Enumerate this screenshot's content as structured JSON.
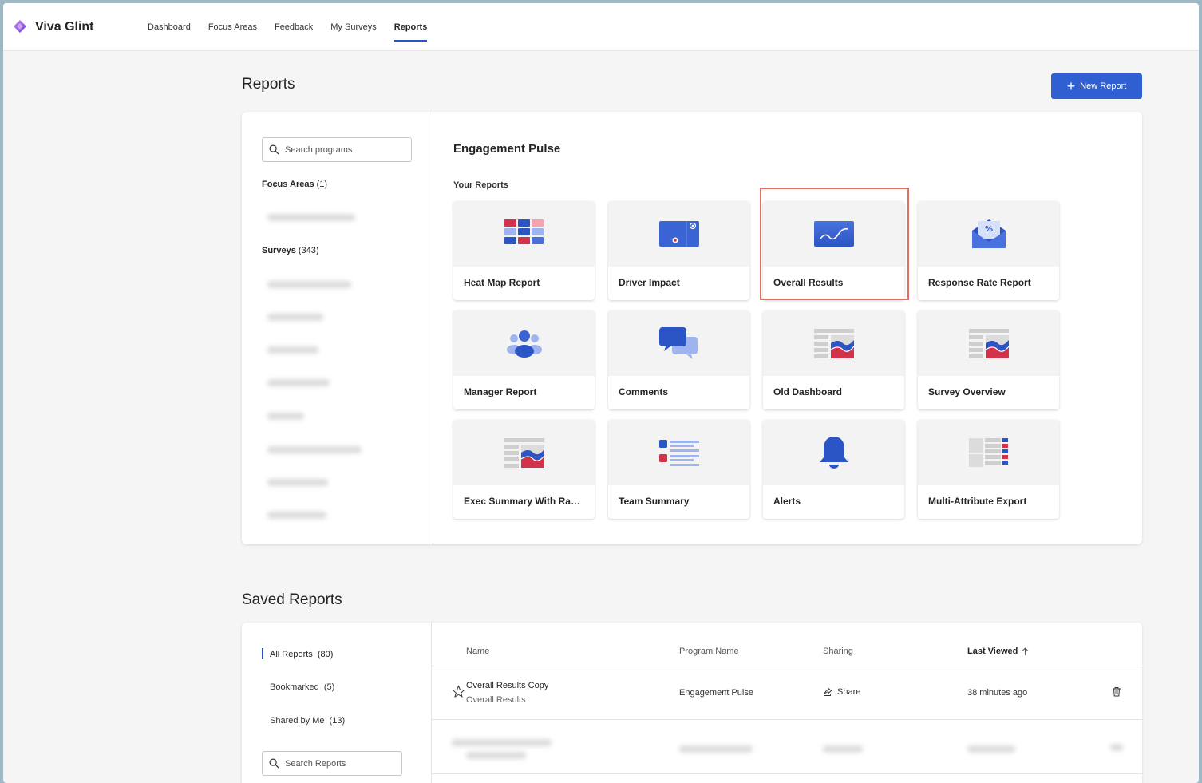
{
  "app": {
    "name": "Viva Glint"
  },
  "nav": {
    "items": [
      {
        "label": "Dashboard"
      },
      {
        "label": "Focus Areas"
      },
      {
        "label": "Feedback"
      },
      {
        "label": "My Surveys"
      },
      {
        "label": "Reports"
      }
    ],
    "active": "Reports"
  },
  "reports": {
    "title": "Reports",
    "new_report_label": "New Report",
    "search_placeholder": "Search programs",
    "focus_areas": {
      "label": "Focus Areas",
      "count": "(1)"
    },
    "surveys": {
      "label": "Surveys",
      "count": "(343)"
    },
    "program_title": "Engagement Pulse",
    "your_reports_label": "Your Reports",
    "cards": [
      {
        "label": "Heat Map Report",
        "icon": "heatmap-icon"
      },
      {
        "label": "Driver Impact",
        "icon": "driver-impact-icon"
      },
      {
        "label": "Overall Results",
        "icon": "trend-line-icon"
      },
      {
        "label": "Response Rate Report",
        "icon": "envelope-percent-icon"
      },
      {
        "label": "Manager Report",
        "icon": "people-icon"
      },
      {
        "label": "Comments",
        "icon": "chat-bubbles-icon"
      },
      {
        "label": "Old Dashboard",
        "icon": "dashboard-icon"
      },
      {
        "label": "Survey Overview",
        "icon": "dashboard-icon"
      },
      {
        "label": "Exec Summary With Radi...",
        "icon": "dashboard-icon"
      },
      {
        "label": "Team Summary",
        "icon": "list-icon"
      },
      {
        "label": "Alerts",
        "icon": "bell-icon"
      },
      {
        "label": "Multi-Attribute Export",
        "icon": "table-export-icon"
      }
    ]
  },
  "saved": {
    "title": "Saved Reports",
    "filters": [
      {
        "label": "All Reports",
        "count": "(80)"
      },
      {
        "label": "Bookmarked",
        "count": "(5)"
      },
      {
        "label": "Shared by Me",
        "count": "(13)"
      }
    ],
    "search_placeholder": "Search Reports",
    "columns": {
      "name": "Name",
      "program": "Program Name",
      "sharing": "Sharing",
      "last_viewed": "Last Viewed"
    },
    "rows": [
      {
        "name": "Overall Results Copy",
        "type": "Overall Results",
        "program": "Engagement Pulse",
        "sharing": "Share",
        "last_viewed": "38 minutes ago"
      }
    ]
  },
  "colors": {
    "accent": "#2f5fd0",
    "highlight": "#e0705f",
    "red": "#d0334a"
  }
}
